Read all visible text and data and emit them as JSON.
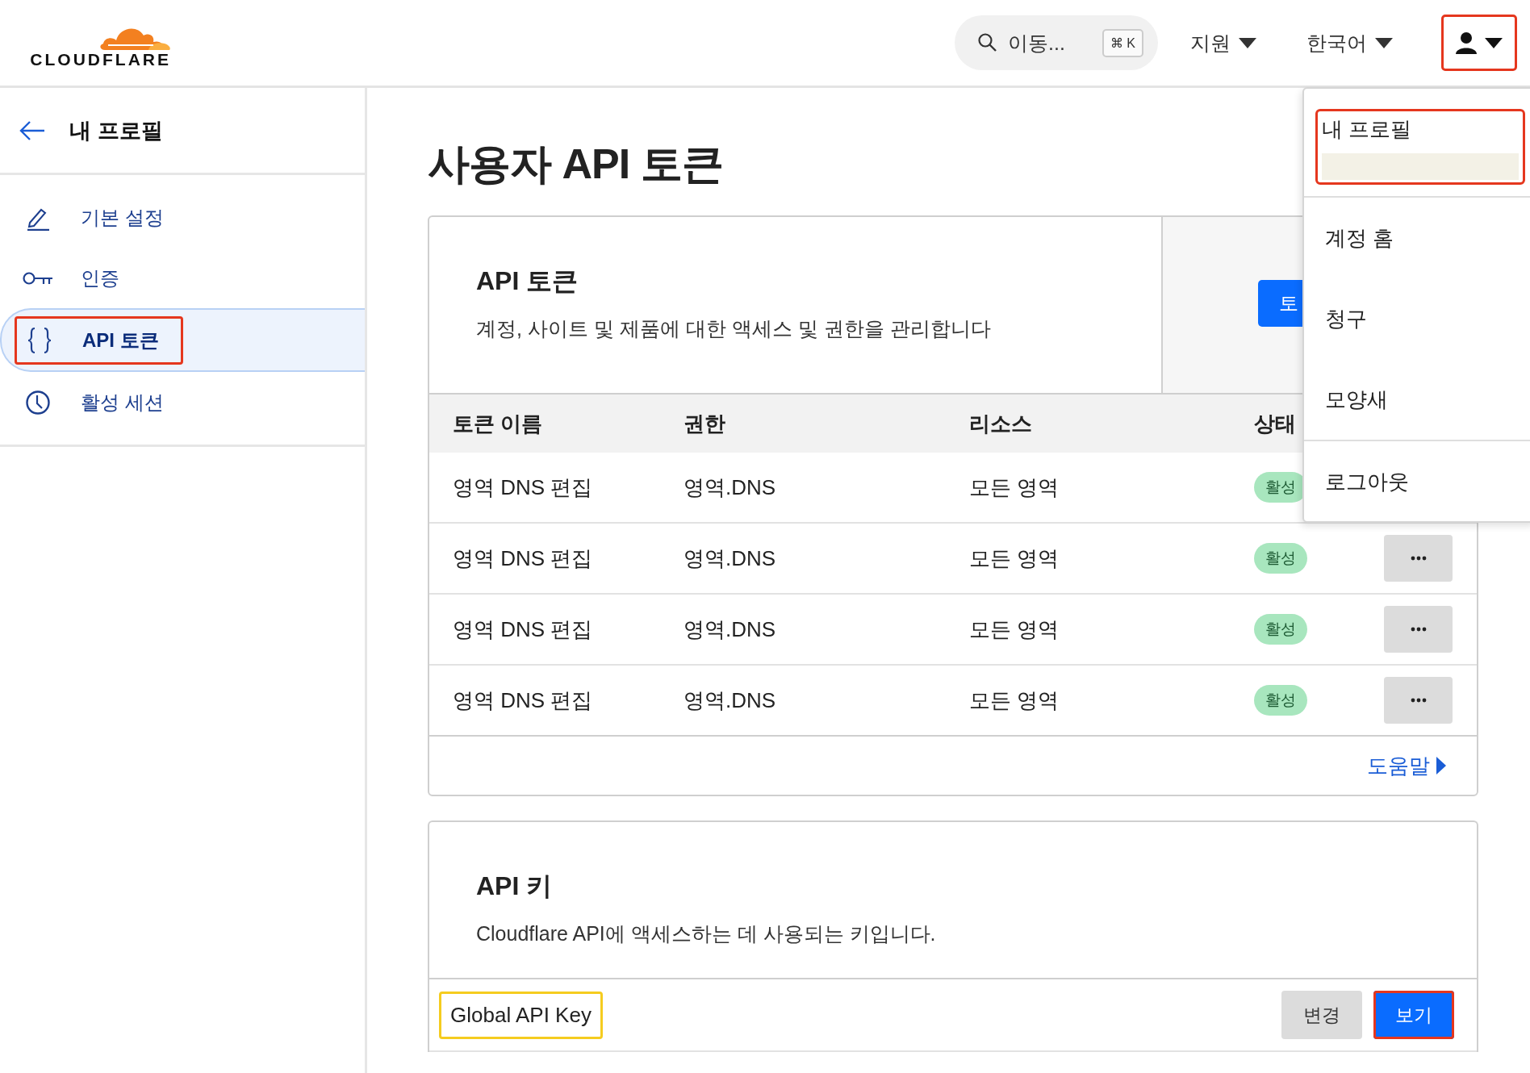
{
  "header": {
    "logo": "CLOUDFLARE",
    "search": {
      "placeholder": "이동...",
      "shortcut": "⌘ K"
    },
    "menus": [
      {
        "label": "지원"
      },
      {
        "label": "한국어"
      }
    ],
    "user_button": {
      "highlight": {
        "color": "#e5371e"
      }
    }
  },
  "sidebar": {
    "back_label": "내 프로필",
    "items": [
      {
        "label": "기본 설정",
        "kind": "pencil",
        "selected": false
      },
      {
        "label": "인증",
        "kind": "key",
        "selected": false
      },
      {
        "label": "API 토큰",
        "kind": "braces",
        "selected": true,
        "highlight": {
          "color": "#e5371e"
        }
      },
      {
        "label": "활성 세션",
        "kind": "clock",
        "selected": false
      }
    ]
  },
  "page_title": "사용자 API 토큰",
  "tokens_card": {
    "title": "API 토큰",
    "description": "계정, 사이트 및 제품에 대한 액세스 및 권한을 관리합니다",
    "create_button": "토",
    "columns": [
      "토큰 이름",
      "권한",
      "리소스",
      "상태"
    ],
    "rows": [
      {
        "name": "영역 DNS 편집",
        "permission": "영역.DNS",
        "resource": "모든 영역",
        "status": "활성",
        "more_button": false
      },
      {
        "name": "영역 DNS 편집",
        "permission": "영역.DNS",
        "resource": "모든 영역",
        "status": "활성",
        "more_button": true
      },
      {
        "name": "영역 DNS 편집",
        "permission": "영역.DNS",
        "resource": "모든 영역",
        "status": "활성",
        "more_button": true
      },
      {
        "name": "영역 DNS 편집",
        "permission": "영역.DNS",
        "resource": "모든 영역",
        "status": "활성",
        "more_button": true
      }
    ],
    "help_link": "도움말"
  },
  "keys_card": {
    "title": "API 키",
    "description": "Cloudflare API에 액세스하는 데 사용되는 키입니다.",
    "rows": [
      {
        "label": "Global API Key",
        "highlight": {
          "color": "#f5cc1f"
        },
        "buttons": [
          {
            "label": "변경",
            "kind": "secondary"
          },
          {
            "label": "보기",
            "kind": "primary",
            "highlight": {
              "color": "#e5371e"
            }
          }
        ]
      }
    ]
  },
  "dropdown": {
    "sections": [
      [
        {
          "label": "내 프로필",
          "highlight": {
            "color": "#e5371e"
          },
          "redacted": true
        }
      ],
      [
        {
          "label": "계정 홈"
        },
        {
          "label": "청구"
        },
        {
          "label": "모양새"
        }
      ],
      [
        {
          "label": "로그아웃"
        }
      ]
    ]
  }
}
